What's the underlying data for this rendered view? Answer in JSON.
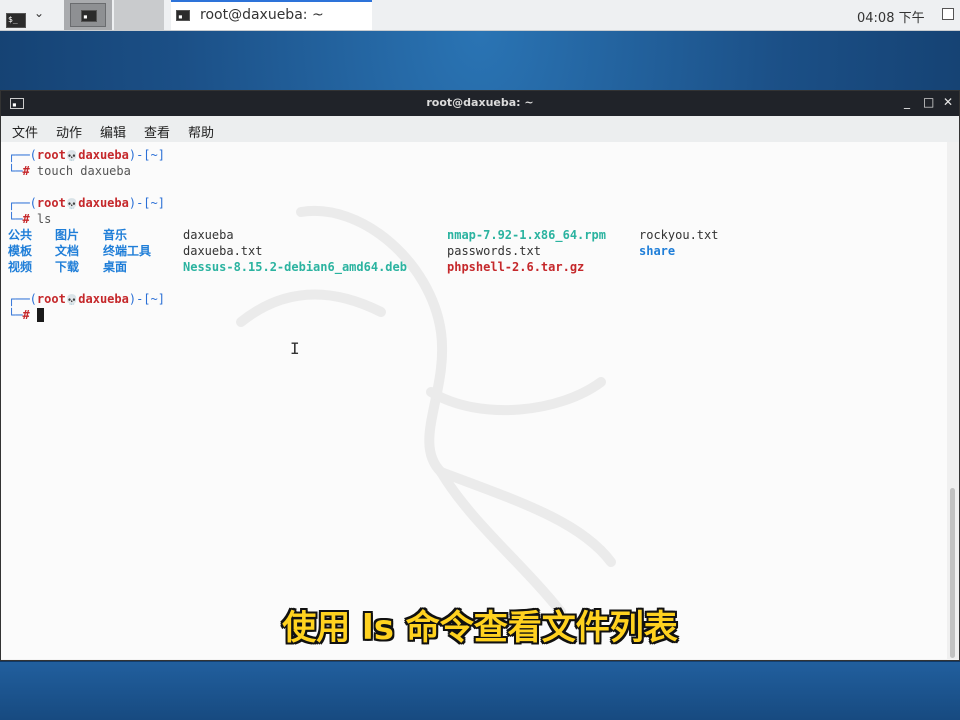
{
  "panel": {
    "taskbar_title": "root@daxueba: ~",
    "clock": "04:08 下午"
  },
  "window": {
    "title": "root@daxueba: ~",
    "controls": [
      "_",
      "□",
      "✕"
    ],
    "menu": [
      "文件",
      "动作",
      "编辑",
      "查看",
      "帮助"
    ]
  },
  "terminal": {
    "user": "root",
    "host": "daxueba",
    "cwd": "~",
    "commands": [
      "touch daxueba",
      "ls"
    ],
    "prompt_symbol": "#",
    "ls_output": [
      [
        "公共",
        "图片",
        "音乐",
        "daxueba",
        "nmap-7.92-1.x86_64.rpm",
        "rockyou.txt"
      ],
      [
        "模板",
        "文档",
        "终端工具",
        "daxueba.txt",
        "passwords.txt",
        "share"
      ],
      [
        "视频",
        "下载",
        "桌面",
        "Nessus-8.15.2-debian6_amd64.deb",
        "phpshell-2.6.tar.gz"
      ]
    ]
  },
  "subtitle": "使用 ls 命令查看文件列表",
  "colors": {
    "prompt_red": "#c5282b",
    "bracket_blue": "#2a6fd6",
    "dir_blue": "#1f7ed8",
    "exe_teal": "#2bb3a0",
    "subtitle_yellow": "#ffd21f"
  }
}
